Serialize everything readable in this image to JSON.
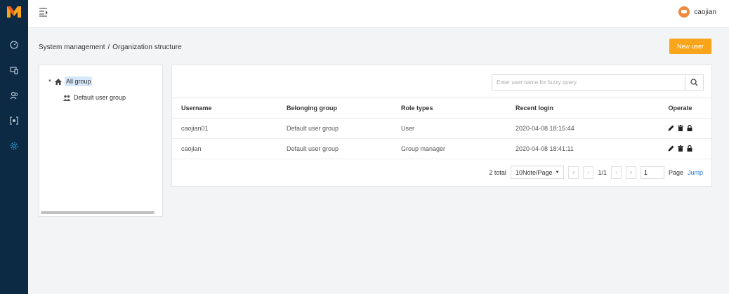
{
  "sidebar": {
    "logo": "M",
    "items": [
      {
        "name": "dashboard-icon"
      },
      {
        "name": "devices-icon"
      },
      {
        "name": "users-icon"
      },
      {
        "name": "monitor-icon"
      },
      {
        "name": "settings-icon"
      }
    ],
    "active_color": "#2a9be2",
    "background": "#0c2a43"
  },
  "header": {
    "username": "caojian"
  },
  "breadcrumb": {
    "parent": "System management",
    "separator": "/",
    "current": "Organization structure"
  },
  "toolbar": {
    "new_user_label": "New user",
    "accent": "#f8a51b"
  },
  "tree": {
    "root_label": "All group",
    "children": [
      "Default user group"
    ]
  },
  "search": {
    "placeholder": "Enter user name for fuzzy query.",
    "value": ""
  },
  "table": {
    "headers": [
      "Username",
      "Belonging group",
      "Role types",
      "Recent login",
      "Operate"
    ],
    "rows": [
      [
        "caojian01",
        "Default user group",
        "User",
        "2020-04-08 18:15:44"
      ],
      [
        "caojian",
        "Default user group",
        "Group manager",
        "2020-04-08 18:41:11"
      ]
    ]
  },
  "pagination": {
    "total": "2 total",
    "page_size": "10Note/Page",
    "first": "«",
    "prev": "‹",
    "current": "1/1",
    "next": "›",
    "last": "»",
    "page_input": "1",
    "page_label": "Page",
    "jump_label": "Jump"
  }
}
